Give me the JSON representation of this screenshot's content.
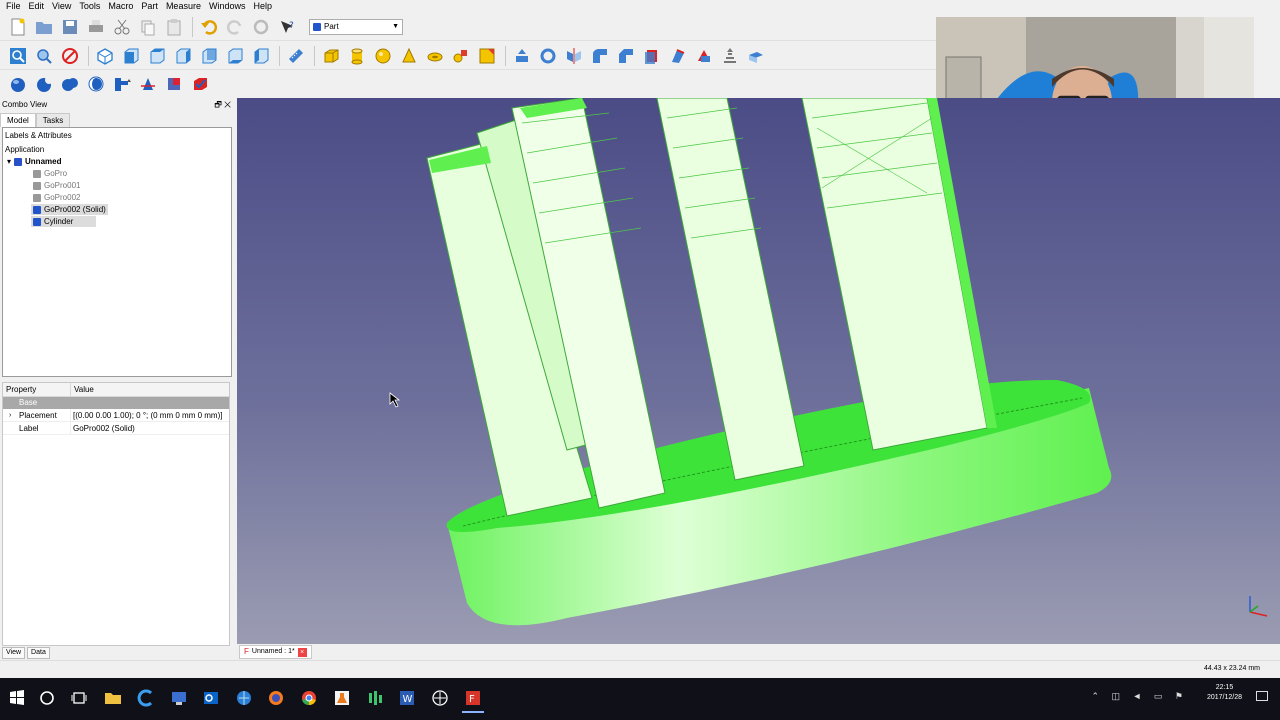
{
  "menu": [
    "File",
    "Edit",
    "View",
    "Tools",
    "Macro",
    "Part",
    "Measure",
    "Windows",
    "Help"
  ],
  "workbench": {
    "selected": "Part"
  },
  "combo": {
    "title": "Combo View",
    "tabs": [
      "Model",
      "Tasks"
    ],
    "tree": {
      "header": "Labels & Attributes",
      "section": "Application",
      "document": "Unnamed",
      "items": [
        {
          "label": "GoPro",
          "hidden": true
        },
        {
          "label": "GoPro001",
          "hidden": true
        },
        {
          "label": "GoPro002",
          "hidden": true
        },
        {
          "label": "GoPro002 (Solid)",
          "hidden": false
        },
        {
          "label": "Cylinder",
          "hidden": false
        }
      ]
    },
    "properties": {
      "columns": [
        "Property",
        "Value"
      ],
      "group": "Base",
      "rows": [
        {
          "name": "Placement",
          "value": "[(0.00 0.00 1.00); 0 °; (0 mm  0 mm  0 mm)]"
        },
        {
          "name": "Label",
          "value": "GoPro002 (Solid)"
        }
      ]
    },
    "bottom_tabs": [
      "View",
      "Data"
    ]
  },
  "document_tab": {
    "label": "Unnamed : 1*"
  },
  "status": {
    "dimensions": "44.43 x 23.24 mm"
  },
  "taskbar": {
    "time": "22:15",
    "date": "2017/12/28"
  },
  "colors": {
    "model_green": "#66f05a",
    "face_light": "#eaffe0",
    "bg_top": "#4b4c86",
    "bg_bottom": "#9b9cb2"
  }
}
